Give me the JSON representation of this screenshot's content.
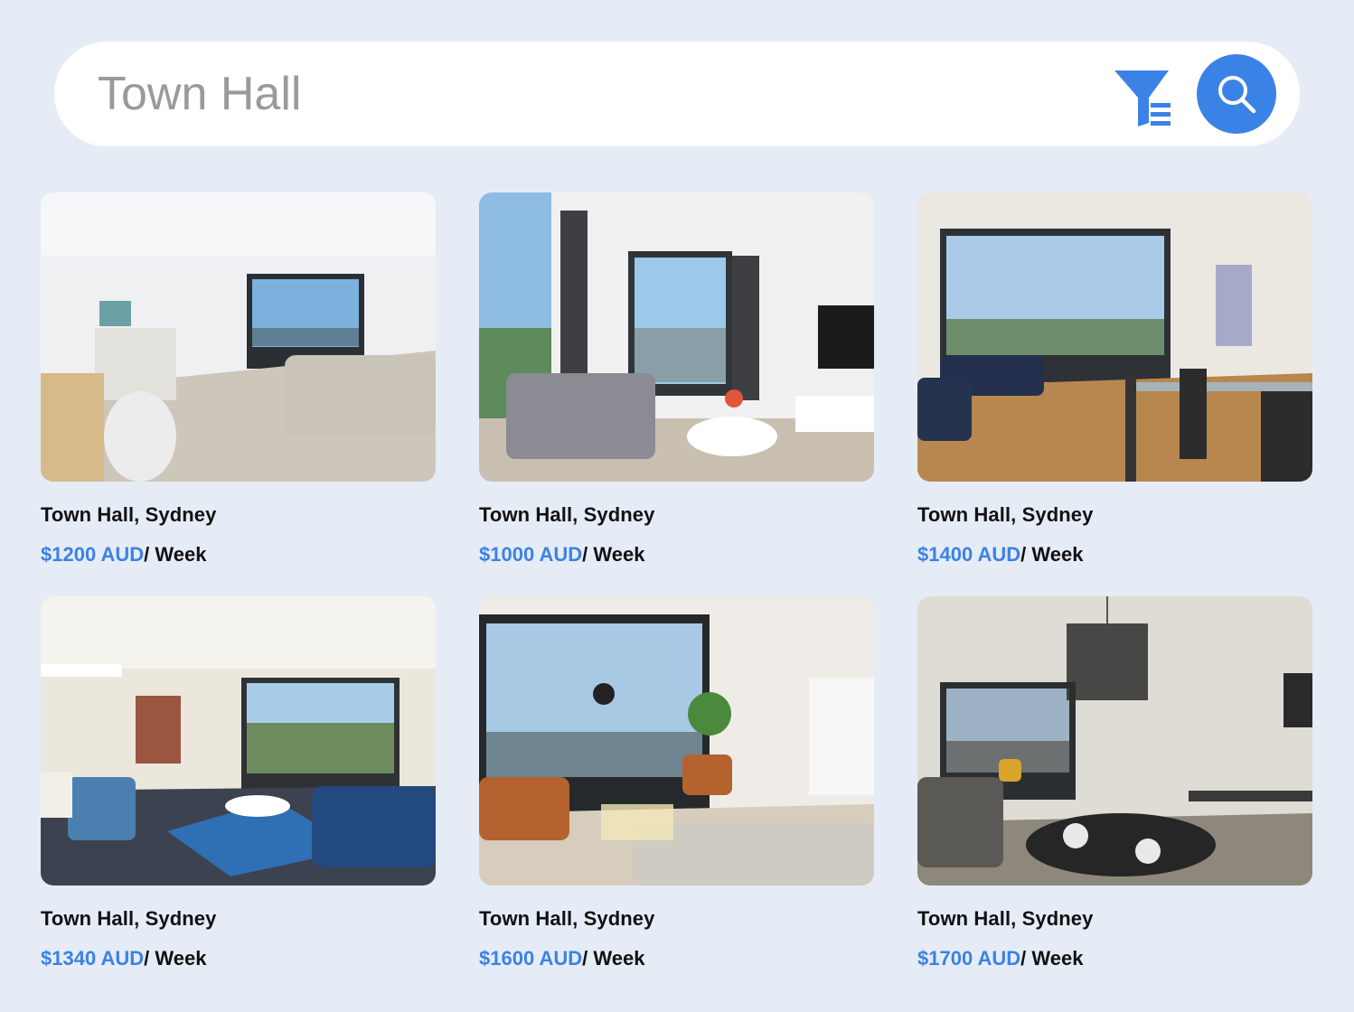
{
  "search": {
    "value": "Town Hall",
    "filter_icon": "filter-icon",
    "search_icon": "search-icon"
  },
  "colors": {
    "accent": "#3b82e6",
    "background": "#e6ecf6"
  },
  "listings": [
    {
      "location": "Town Hall, Sydney",
      "price": "$1200 AUD",
      "period": "/ Week"
    },
    {
      "location": "Town Hall, Sydney",
      "price": "$1000 AUD",
      "period": "/ Week"
    },
    {
      "location": "Town Hall, Sydney",
      "price": "$1400 AUD",
      "period": "/ Week"
    },
    {
      "location": "Town Hall, Sydney",
      "price": "$1340 AUD",
      "period": "/ Week"
    },
    {
      "location": "Town Hall, Sydney",
      "price": "$1600 AUD",
      "period": "/ Week"
    },
    {
      "location": "Town Hall, Sydney",
      "price": "$1700 AUD",
      "period": "/ Week"
    }
  ]
}
